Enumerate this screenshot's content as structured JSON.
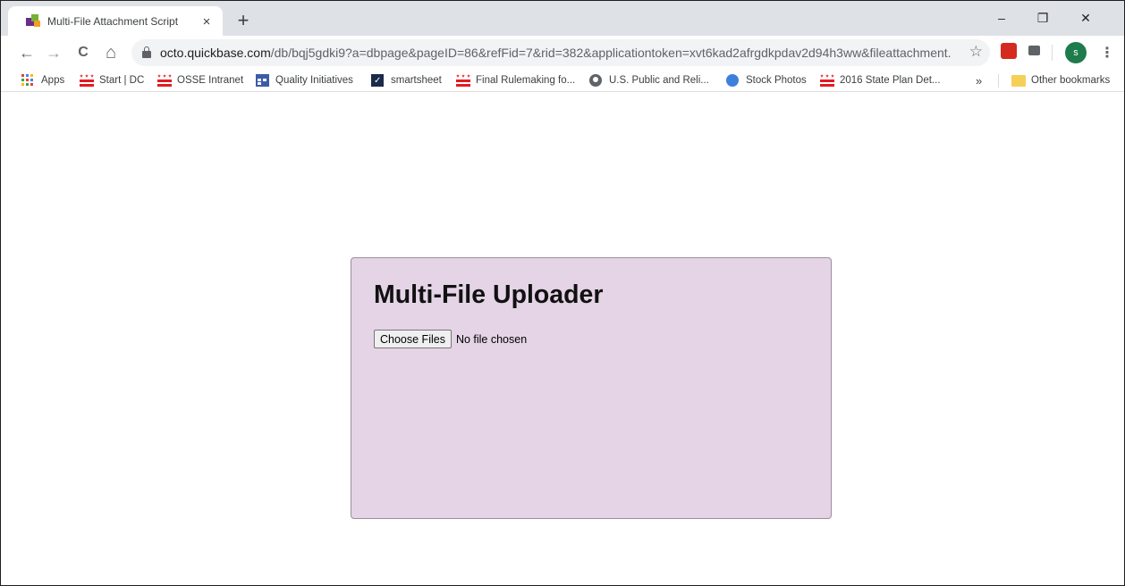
{
  "tab": {
    "title": "Multi-File Attachment Script",
    "close": "×",
    "new_tab": "+"
  },
  "window_controls": {
    "minimize": "–",
    "restore": "❐",
    "close": "✕"
  },
  "toolbar": {
    "back": "←",
    "forward": "→",
    "reload": "C",
    "home": "⌂",
    "url_host": "octo.quickbase.com",
    "url_path": "/db/bqj5gdki9?a=dbpage&pageID=86&refFid=7&rid=382&applicationtoken=xvt6kad2afrgdkpdav2d94h3ww&fileattachment...",
    "star": "☆",
    "profile_initial": "s",
    "menu": "⋮"
  },
  "bookmarks": {
    "apps": "Apps",
    "items": [
      {
        "label": "Start | DC",
        "icon": "dc-flag-icon"
      },
      {
        "label": "OSSE Intranet",
        "icon": "dc-flag-icon"
      },
      {
        "label": "Quality Initiatives",
        "icon": "calendar-icon"
      },
      {
        "label": "smartsheet",
        "icon": "smartsheet-icon"
      },
      {
        "label": "Final Rulemaking fo...",
        "icon": "dc-flag-icon"
      },
      {
        "label": "U.S. Public and Reli...",
        "icon": "globe-icon"
      },
      {
        "label": "Stock Photos",
        "icon": "blue-circle-icon"
      },
      {
        "label": "2016 State Plan Det...",
        "icon": "dc-flag-icon"
      }
    ],
    "overflow": "»",
    "other": "Other bookmarks"
  },
  "uploader": {
    "title": "Multi-File Uploader",
    "choose_label": "Choose Files",
    "status": "No file chosen"
  },
  "colors": {
    "panel_bg": "#e4d4e6",
    "tabstrip_bg": "#dee1e6",
    "profile_bg": "#1e7b4c"
  }
}
